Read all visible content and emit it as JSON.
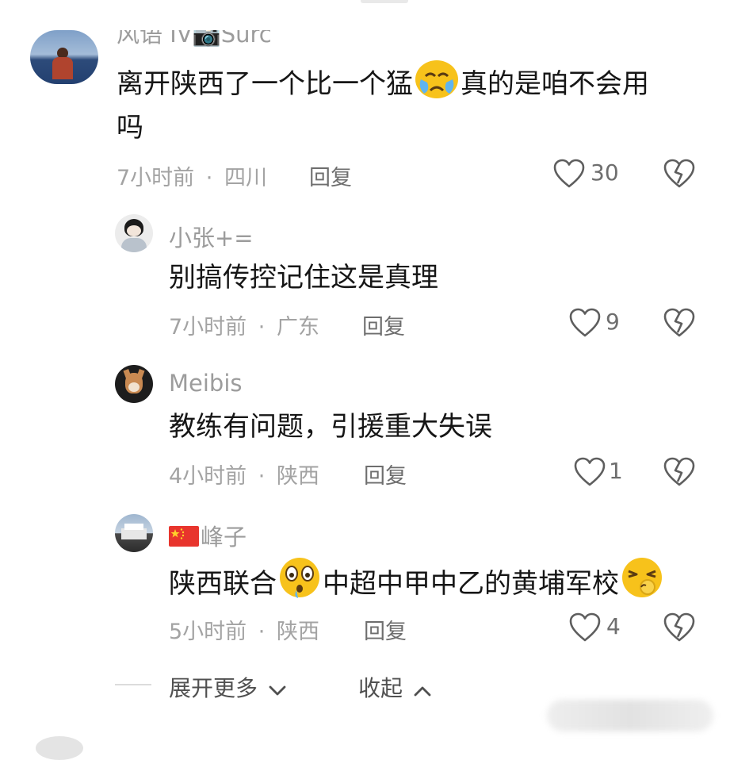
{
  "comments": [
    {
      "username": "风语 IV📷Surc",
      "text_line1_a": "离开陕西了一个比一个猛",
      "text_line1_b": "真的是咱不会用",
      "text_line2": "吗",
      "time": "7小时前",
      "location": "四川",
      "reply_label": "回复",
      "likes": "30"
    },
    {
      "username": "小张+=",
      "text": "别搞传控记住这是真理",
      "time": "7小时前",
      "location": "广东",
      "reply_label": "回复",
      "likes": "9"
    },
    {
      "username": "Meibis",
      "text": "教练有问题，引援重大失误",
      "time": "4小时前",
      "location": "陕西",
      "reply_label": "回复",
      "likes": "1"
    },
    {
      "username": "峰子",
      "text_a": "陕西联合",
      "text_b": "中超中甲中乙的黄埔军校",
      "time": "5小时前",
      "location": "陕西",
      "reply_label": "回复",
      "likes": "4"
    }
  ],
  "meta_separator": "·",
  "footer": {
    "expand_label": "展开更多",
    "collapse_label": "收起"
  },
  "icons": {
    "like": "heart-outline-icon",
    "dislike": "broken-heart-icon",
    "expand": "chevron-down-icon",
    "collapse": "chevron-up-icon",
    "crying_emoji": "crying-face-emoji",
    "shocked_emoji": "shocked-face-emoji",
    "shush_emoji": "shushing-face-emoji",
    "flag": "china-flag-icon"
  },
  "colors": {
    "username": "#9c9c9c",
    "meta": "#a3a3a3",
    "reply": "#6e6e6e",
    "text": "#161616",
    "emoji_yellow": "#f7c21b"
  }
}
